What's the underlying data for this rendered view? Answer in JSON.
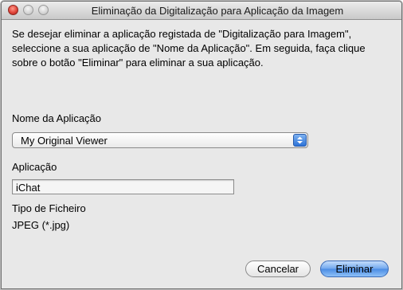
{
  "window": {
    "title": "Eliminação da Digitalização para Aplicação da Imagem"
  },
  "dialog": {
    "description": "Se desejar eliminar a aplicação registada de \"Digitalização para Imagem\", seleccione a sua aplicação de \"Nome da Aplicação\". Em seguida, faça clique sobre o botão \"Eliminar\" para eliminar a sua aplicação.",
    "app_name_label": "Nome da Aplicação",
    "app_name_value": "My Original Viewer",
    "application_label": "Aplicação",
    "application_value": "iChat",
    "file_type_label": "Tipo de Ficheiro",
    "file_type_value": "JPEG (*.jpg)"
  },
  "buttons": {
    "cancel": "Cancelar",
    "delete": "Eliminar"
  },
  "colors": {
    "accent": "#4a8be3",
    "close": "#e0443a"
  }
}
